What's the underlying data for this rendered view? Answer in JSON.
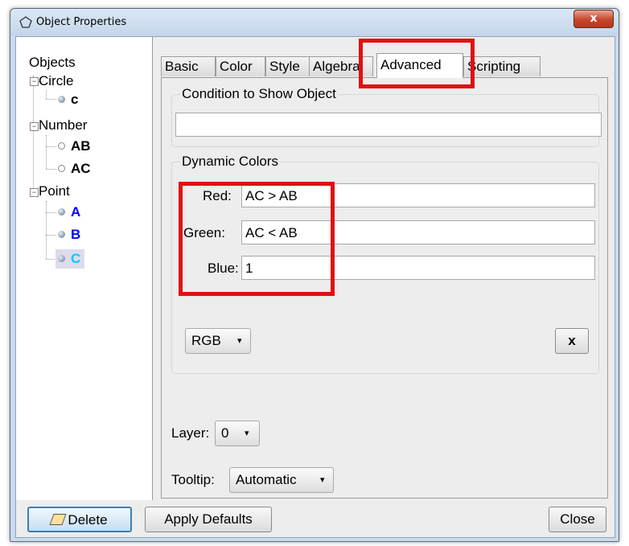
{
  "window": {
    "title": "Object Properties",
    "close_glyph": "x"
  },
  "tree": {
    "root_label": "Objects",
    "groups": [
      {
        "label": "Circle",
        "children": [
          {
            "label": "c",
            "color": "#000000"
          }
        ]
      },
      {
        "label": "Number",
        "children": [
          {
            "label": "AB",
            "color": "#000000"
          },
          {
            "label": "AC",
            "color": "#000000"
          }
        ]
      },
      {
        "label": "Point",
        "children": [
          {
            "label": "A",
            "color": "#0000ff"
          },
          {
            "label": "B",
            "color": "#0000ff"
          },
          {
            "label": "C",
            "color": "#00c8ff"
          }
        ]
      }
    ]
  },
  "tabs": [
    "Basic",
    "Color",
    "Style",
    "Algebra",
    "Advanced",
    "Scripting"
  ],
  "active_tab": "Advanced",
  "advanced": {
    "condition_title": "Condition to Show Object",
    "condition_value": "",
    "dynamic_title": "Dynamic Colors",
    "red_label": "Red:",
    "red_value": "AC > AB",
    "green_label": "Green:",
    "green_value": "AC < AB",
    "blue_label": "Blue:",
    "blue_value": "1",
    "color_mode": "RGB",
    "clear_button": "x",
    "layer_label": "Layer:",
    "layer_value": "0",
    "tooltip_label": "Tooltip:",
    "tooltip_value": "Automatic"
  },
  "footer": {
    "delete": "Delete",
    "apply_defaults": "Apply Defaults",
    "close": "Close"
  },
  "colors": {
    "highlight": "#e01010",
    "selected_row": "#dcdcec"
  }
}
